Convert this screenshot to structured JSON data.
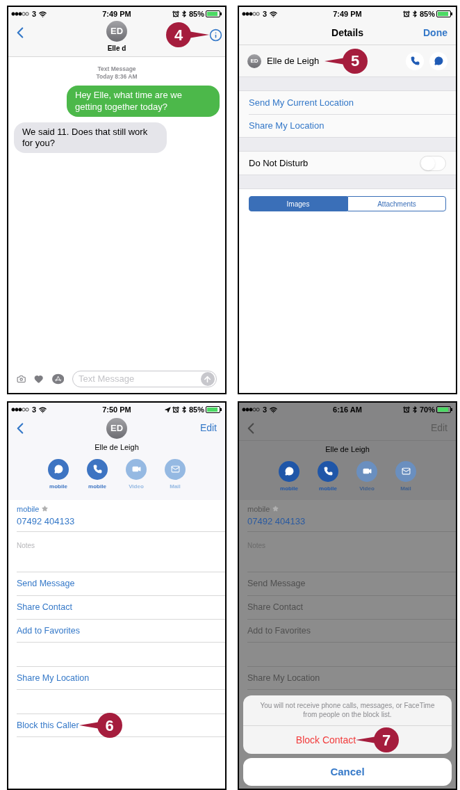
{
  "screens": [
    {
      "kind": "messages",
      "status": {
        "carrier": "3",
        "time": "7:49 PM",
        "battery": "85%"
      },
      "header": {
        "initials": "ED",
        "name": "Elle d"
      },
      "callout": {
        "number": "4",
        "kind": "pointer_right"
      },
      "timestamp": {
        "label": "Text Message",
        "time": "Today 8:36 AM"
      },
      "messages": [
        {
          "text": "Hey Elle, what time are we getting together today?",
          "sent": true
        },
        {
          "text": "We said 11. Does that still work for you?",
          "sent": false
        }
      ],
      "composer": {
        "placeholder": "Text Message"
      }
    },
    {
      "kind": "details",
      "status": {
        "carrier": "3",
        "time": "7:49 PM",
        "battery": "85%"
      },
      "title": "Details",
      "done": "Done",
      "contact": {
        "initials": "ED",
        "name": "Elle de Leigh"
      },
      "callout": {
        "number": "5",
        "kind": "pointer_left"
      },
      "location_items": [
        "Send My Current Location",
        "Share My Location"
      ],
      "dnd": {
        "label": "Do Not Disturb",
        "on": false
      },
      "segments": [
        {
          "label": "Images",
          "selected": true
        },
        {
          "label": "Attachments",
          "selected": false
        }
      ]
    },
    {
      "kind": "contact",
      "dimmed": false,
      "status": {
        "carrier": "3",
        "time": "7:50 PM",
        "battery": "85%",
        "location": true
      },
      "edit": "Edit",
      "initials": "ED",
      "name": "Elle de Leigh",
      "actions": [
        {
          "kind": "message",
          "label": "mobile",
          "disabled": false
        },
        {
          "kind": "phone",
          "label": "mobile",
          "disabled": false
        },
        {
          "kind": "video",
          "label": "Video",
          "disabled": true
        },
        {
          "kind": "mail",
          "label": "Mail",
          "disabled": true
        }
      ],
      "phone": {
        "label": "mobile",
        "number": "07492 404133"
      },
      "notes_label": "Notes",
      "groups": [
        [
          {
            "label": "Send Message"
          },
          {
            "label": "Share Contact"
          },
          {
            "label": "Add to Favorites"
          }
        ],
        [
          {
            "label": "Share My Location"
          }
        ],
        [
          {
            "label": "Block this Caller",
            "callout": {
              "number": "6",
              "kind": "pointer_left"
            }
          }
        ]
      ]
    },
    {
      "kind": "contact",
      "dimmed": true,
      "status": {
        "carrier": "3",
        "time": "6:16 AM",
        "battery": "70%"
      },
      "edit": "Edit",
      "name": "Elle de Leigh",
      "actions": [
        {
          "kind": "message",
          "label": "mobile",
          "disabled": false
        },
        {
          "kind": "phone",
          "label": "mobile",
          "disabled": false
        },
        {
          "kind": "video",
          "label": "Video",
          "disabled": true
        },
        {
          "kind": "mail",
          "label": "Mail",
          "disabled": true
        }
      ],
      "phone": {
        "label": "mobile",
        "number": "07492 404133"
      },
      "notes_label": "Notes",
      "groups": [
        [
          {
            "label": "Send Message"
          },
          {
            "label": "Share Contact"
          },
          {
            "label": "Add to Favorites"
          }
        ],
        [
          {
            "label": "Share My Location"
          }
        ]
      ],
      "sheet": {
        "message": "You will not receive phone calls, messages, or FaceTime from people on the block list.",
        "action": "Block Contact",
        "cancel": "Cancel",
        "callout": {
          "number": "7",
          "kind": "pointer_left"
        }
      }
    }
  ]
}
